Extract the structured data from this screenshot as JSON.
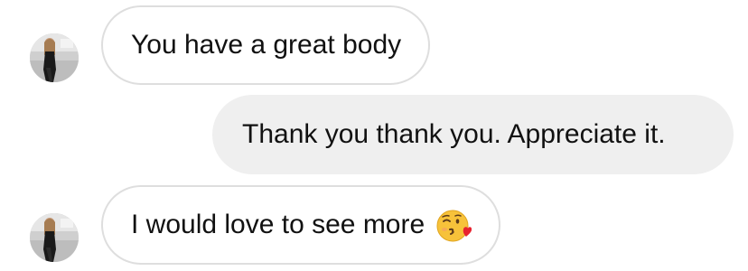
{
  "conversation": {
    "messages": [
      {
        "direction": "incoming",
        "text": "You have a great body"
      },
      {
        "direction": "outgoing",
        "text": "Thank you thank you. Appreciate it."
      },
      {
        "direction": "incoming",
        "text": "I would love to see more",
        "emoji": "face-blowing-kiss"
      }
    ]
  },
  "colors": {
    "incoming_bubble_bg": "#ffffff",
    "incoming_bubble_border": "#dedede",
    "outgoing_bubble_bg": "#efefef",
    "text": "#111111"
  }
}
